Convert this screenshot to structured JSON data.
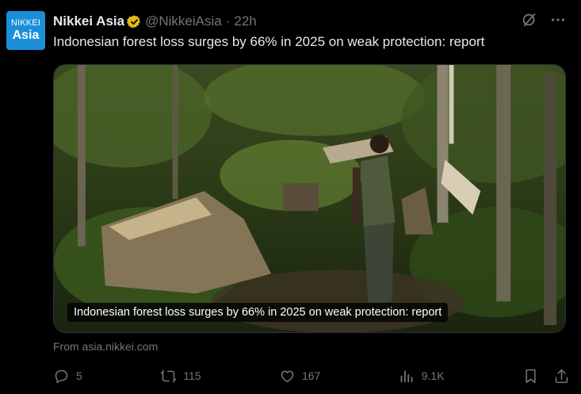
{
  "avatar": {
    "line1": "NIKKEI",
    "line2": "Asia"
  },
  "header": {
    "name": "Nikkei Asia",
    "handle": "@NikkeiAsia",
    "separator": "·",
    "time": "22h"
  },
  "icons": {
    "grok": "grok-icon",
    "more": "more-icon",
    "verified": "verified-badge-icon"
  },
  "tweet": {
    "text": "Indonesian forest loss surges by 66% in 2025 on weak protection: report"
  },
  "card": {
    "caption": "Indonesian forest loss surges by 66% in 2025 on weak protection: report",
    "source": "From asia.nikkei.com"
  },
  "actions": {
    "replies": "5",
    "reposts": "115",
    "likes": "167",
    "views": "9.1K"
  },
  "colors": {
    "accent": "#1d9bf0",
    "muted": "#71767b",
    "verified": "#e2b719",
    "avatar_bg": "#1a8fd8"
  }
}
